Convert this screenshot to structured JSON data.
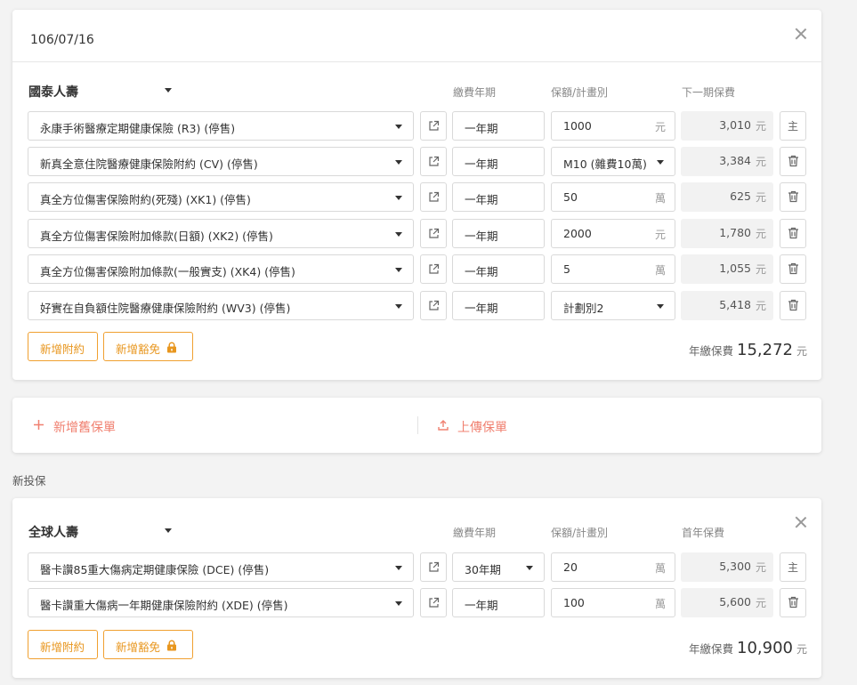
{
  "existing_policy": {
    "date": "106/07/16",
    "company": "國泰人壽",
    "col_period": "繳費年期",
    "col_amount": "保額/計畫別",
    "col_premium": "下一期保費",
    "rows": [
      {
        "plan": "永康手術醫療定期健康保險 (R3) (停售)",
        "period": "一年期",
        "amount": "1000",
        "amount_unit": "元",
        "premium": "3,010",
        "premium_unit": "元",
        "action": "主"
      },
      {
        "plan": "新真全意住院醫療健康保險附約 (CV) (停售)",
        "period": "一年期",
        "amount": "M10 (雜費10萬)",
        "amount_unit": "",
        "premium": "3,384",
        "premium_unit": "元",
        "action": "trash-icon"
      },
      {
        "plan": "真全方位傷害保險附約(死殘) (XK1) (停售)",
        "period": "一年期",
        "amount": "50",
        "amount_unit": "萬",
        "premium": "625",
        "premium_unit": "元",
        "action": "trash-icon"
      },
      {
        "plan": "真全方位傷害保險附加條款(日額) (XK2) (停售)",
        "period": "一年期",
        "amount": "2000",
        "amount_unit": "元",
        "premium": "1,780",
        "premium_unit": "元",
        "action": "trash-icon"
      },
      {
        "plan": "真全方位傷害保險附加條款(一般實支) (XK4) (停售)",
        "period": "一年期",
        "amount": "5",
        "amount_unit": "萬",
        "premium": "1,055",
        "premium_unit": "元",
        "action": "trash-icon"
      },
      {
        "plan": "好實在自負額住院醫療健康保險附約 (WV3) (停售)",
        "period": "一年期",
        "amount": "計劃別2",
        "amount_unit": "",
        "premium": "5,418",
        "premium_unit": "元",
        "action": "trash-icon"
      }
    ],
    "add_rider": "新增附約",
    "add_waiver": "新增豁免",
    "total_label": "年繳保費",
    "total_value": "15,272",
    "total_unit": "元"
  },
  "actions": {
    "add_old_policy": "新增舊保單",
    "upload_policy": "上傳保單"
  },
  "new_section_label": "新投保",
  "new_policy": {
    "company": "全球人壽",
    "col_period": "繳費年期",
    "col_amount": "保額/計畫別",
    "col_premium": "首年保費",
    "rows": [
      {
        "plan": "醫卡讚85重大傷病定期健康保險 (DCE) (停售)",
        "period": "30年期",
        "amount": "20",
        "amount_unit": "萬",
        "premium": "5,300",
        "premium_unit": "元",
        "action": "主"
      },
      {
        "plan": "醫卡讚重大傷病一年期健康保險附約 (XDE) (停售)",
        "period": "一年期",
        "amount": "100",
        "amount_unit": "萬",
        "premium": "5,600",
        "premium_unit": "元",
        "action": "trash-icon"
      }
    ],
    "add_rider": "新增附約",
    "add_waiver": "新增豁免",
    "total_label": "年繳保費",
    "total_value": "10,900",
    "total_unit": "元"
  },
  "colors": {
    "accent_orange": "#e8961e",
    "action_red": "#f08070"
  }
}
